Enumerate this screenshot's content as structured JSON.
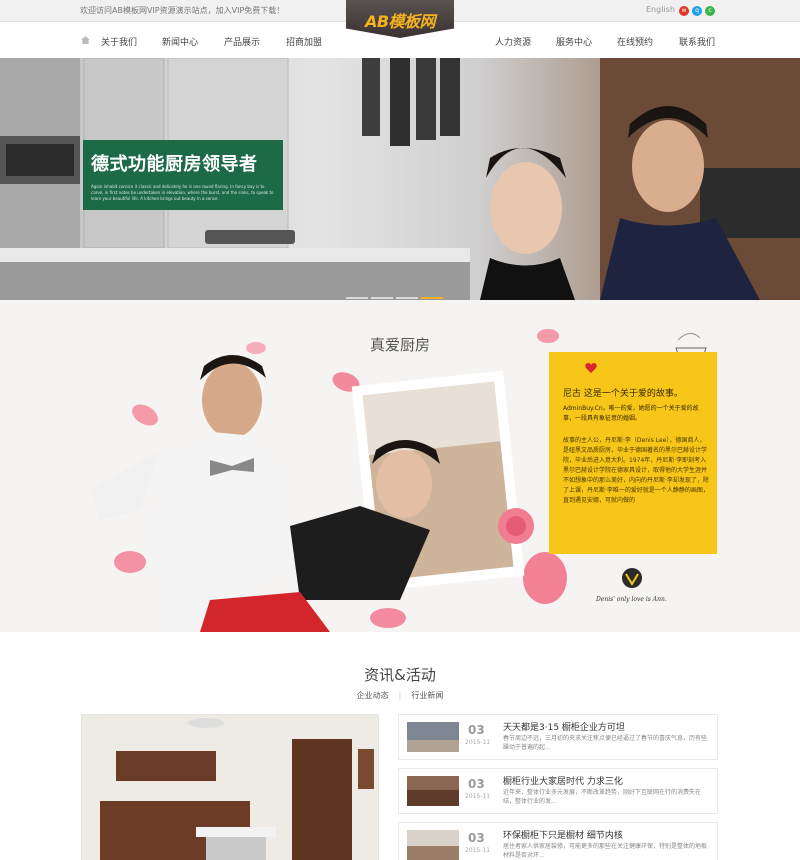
{
  "topbar": {
    "welcome": "欢迎访问AB模板网VIP资源演示站点，加入VIP免费下载！",
    "lang": "English",
    "social": [
      {
        "name": "weibo-icon",
        "color": "#e0352b"
      },
      {
        "name": "qq-icon",
        "color": "#1da1e8"
      },
      {
        "name": "wechat-icon",
        "color": "#3bb54a"
      }
    ]
  },
  "logo": {
    "text": "AB模板网"
  },
  "nav": {
    "left": [
      "关于我们",
      "新闻中心",
      "产品展示",
      "招商加盟"
    ],
    "right": [
      "人力资源",
      "服务中心",
      "在线预约",
      "联系我们"
    ]
  },
  "hero": {
    "headline": "德式功能厨房领导者",
    "subtext": "Again inhabit cornice it classic and delicately he is one round flaring. In fancy bay is to carve, in first notes be undertaken in elevation, where the burst, and the sinks, to speak to learn your beautiful life. A kitchen brings out beauty in a sense.",
    "slides": 4,
    "active_slide": 4
  },
  "love": {
    "title": "真爱厨房",
    "heading": "尼古 这是一个关于爱的故事。",
    "intro": "AdminBuy.Cn，唯一的爱，她愿的一个关于爱的故事，一段具有象征意的婚姻。",
    "story": "故事的主人公，丹尼斯·李（Denis Lee），德国商人，是纽黑文品质厨房，毕业于德国著名的黑尔巴赫设计学院，毕业后进入意大利。1974年，丹尼斯·李即刻考入黑尔巴赫设计学院在德家具设计，取得他的大学生涯并不如想象中的那么美好，内向的丹尼斯·李却发现了，除了上课，丹尼斯·李唯一的爱好就是一个人静静的画图，直到遇见安娜，可就内做的",
    "signature": "Denis' only love is Ann."
  },
  "news": {
    "title": "资讯&活动",
    "tabs": [
      "企业动态",
      "行业新闻"
    ],
    "items": [
      {
        "day": "03",
        "ym": "2015-11",
        "title": "天天都是3·15 橱柜企业方可坦",
        "desc": "春节周边不远，三月初的央求关注焦点便已经逼过了春节的喜庆气息，历有些躁动于普遍的起..."
      },
      {
        "day": "03",
        "ym": "2015-11",
        "title": "橱柜行业大家居时代 力求三化",
        "desc": "近年来，整体行业多元发展，不断改革趋势，刚好下互联网在行的消费失在结，整体行业的发..."
      },
      {
        "day": "03",
        "ym": "2015-11",
        "title": "环保橱柜下只是橱材 细节内核",
        "desc": "居住者家人供家居装修，可能更多的那些在关注健康环保，特别是整体的地板材料是否对环..."
      }
    ]
  }
}
